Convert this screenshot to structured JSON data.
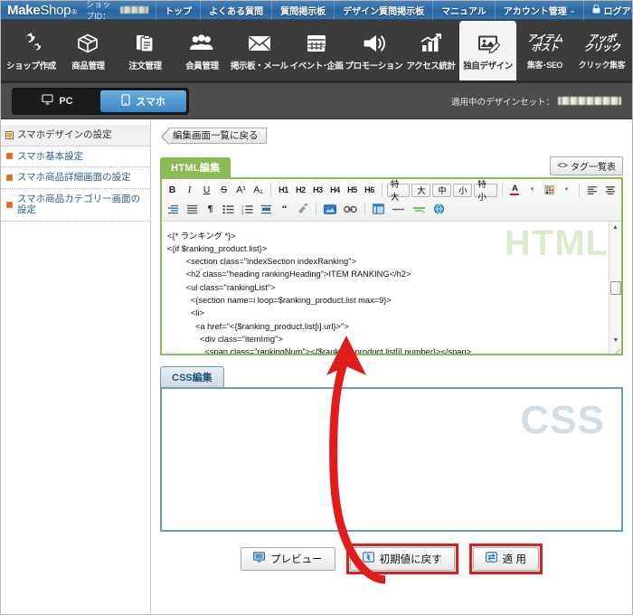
{
  "topbar": {
    "logo_make": "Make",
    "logo_shop": "Shop",
    "logo_reg": "®",
    "shopid_label": "ショップID：",
    "nav": [
      {
        "label": "トップ",
        "icon": "none"
      },
      {
        "label": "よくある質問",
        "icon": "none"
      },
      {
        "label": "質問掲示板",
        "icon": "none"
      },
      {
        "label": "デザイン質問掲示板",
        "icon": "none"
      },
      {
        "label": "マニュアル",
        "icon": "none"
      },
      {
        "label": "アカウント管理",
        "icon": "chevron-down-icon",
        "caret": "⌄"
      },
      {
        "label": "ログアウト",
        "icon": "lock-icon"
      }
    ]
  },
  "iconnav": [
    {
      "label": "ショップ作成",
      "icon": "gears-icon",
      "active": false
    },
    {
      "label": "商品管理",
      "icon": "box-icon",
      "active": false
    },
    {
      "label": "注文管理",
      "icon": "clipboard-icon",
      "active": false
    },
    {
      "label": "会員管理",
      "icon": "users-icon",
      "active": false
    },
    {
      "label": "掲示板・メール",
      "icon": "envelope-icon",
      "active": false
    },
    {
      "label": "イベント･企画",
      "icon": "calendar-icon",
      "active": false
    },
    {
      "label": "プロモーション",
      "icon": "megaphone-icon",
      "active": false
    },
    {
      "label": "アクセス統計",
      "icon": "chart-icon",
      "active": false
    },
    {
      "label": "独自デザイン",
      "icon": "image-pencil-icon",
      "active": true
    },
    {
      "label": "集客･SEO",
      "icon": "itempost-badge",
      "badge_line1": "アイテム",
      "badge_line2": "ポスト",
      "active": false
    },
    {
      "label": "クリック集客",
      "icon": "appoclick-badge",
      "badge_line1": "アッポ",
      "badge_line2": "クリック",
      "active": false
    }
  ],
  "devrow": {
    "pc_label": "PC",
    "sp_label": "スマホ",
    "pc_icon": "monitor-icon",
    "sp_icon": "smartphone-icon",
    "designset_label": "適用中のデザインセット："
  },
  "sidebar": {
    "items": [
      {
        "label": "スマホデザインの設定",
        "icon": "window-icon",
        "selected": true
      },
      {
        "label": "スマホ基本設定",
        "icon": "square-bullet",
        "selected": false
      },
      {
        "label": "スマホ商品詳細画面の設定",
        "icon": "square-bullet",
        "selected": false
      },
      {
        "label": "スマホ商品カテゴリー画面の設定",
        "icon": "square-bullet",
        "selected": false
      }
    ]
  },
  "content": {
    "back_button": "編集画面一覧に戻る",
    "html_tab": "HTML編集",
    "css_tab": "CSS編集",
    "taglist_button": "タグ一覧表",
    "taglist_icon": "code-brackets-icon",
    "html_watermark": "HTML",
    "css_watermark": "CSS"
  },
  "toolbar": {
    "row1": [
      {
        "label": "B",
        "name": "bold-button"
      },
      {
        "label": "I",
        "name": "italic-button"
      },
      {
        "label": "U",
        "name": "underline-button"
      },
      {
        "label": "S",
        "name": "strikethrough-button"
      },
      {
        "label": "A¹",
        "name": "superscript-button"
      },
      {
        "label": "A₁",
        "name": "subscript-button"
      },
      {
        "label": "H1",
        "name": "heading1-button"
      },
      {
        "label": "H2",
        "name": "heading2-button"
      },
      {
        "label": "H3",
        "name": "heading3-button"
      },
      {
        "label": "H4",
        "name": "heading4-button"
      },
      {
        "label": "H5",
        "name": "heading5-button"
      },
      {
        "label": "H6",
        "name": "heading6-button"
      }
    ],
    "sizes": [
      {
        "label": "特大",
        "name": "size-xlarge-button"
      },
      {
        "label": "大",
        "name": "size-large-button"
      },
      {
        "label": "中",
        "name": "size-medium-button"
      },
      {
        "label": "小",
        "name": "size-small-button"
      },
      {
        "label": "特小",
        "name": "size-xsmall-button"
      }
    ],
    "textcolor_label": "A",
    "row2_icons": [
      "indent-icon",
      "justify-icon",
      "paragraph-icon",
      "bullet-list-icon",
      "numbered-list-icon",
      "blockquote-indent-icon",
      "quote-icon",
      "clear-format-icon",
      "image-icon",
      "link-icon",
      "table-icon",
      "horizontal-rule-icon",
      "anchor-icon",
      "globe-icon"
    ]
  },
  "code": {
    "lines": [
      "<{* ランキング *}>",
      "<{if $ranking_product.list}>",
      "        <section class=\"indexSection indexRanking\">",
      "        <h2 class=\"heading rankingHeading\">ITEM RANKING</h2>",
      "        <ul class=\"rankingList\">",
      "          <{section name=i loop=$ranking_product.list max=9}>",
      "          <li>",
      "            <a href=\"<{$ranking_product.list[i].url}>\">",
      "              <div class=\"itemImg\">",
      "                <span class=\"rankingNum\"><{$ranking_product.list[i].number}></span>"
    ]
  },
  "buttons": {
    "preview": {
      "label": "プレビュー",
      "icon": "monitor-icon",
      "highlighted": false
    },
    "reset": {
      "label": "初期値に戻す",
      "icon": "refresh-icon",
      "highlighted": true
    },
    "apply": {
      "label": "適 用",
      "icon": "apply-icon",
      "highlighted": true
    }
  },
  "annotation": {
    "arrow_color": "#e21b1b",
    "description": "red-arrow-from-apply-buttons-to-code-area"
  }
}
